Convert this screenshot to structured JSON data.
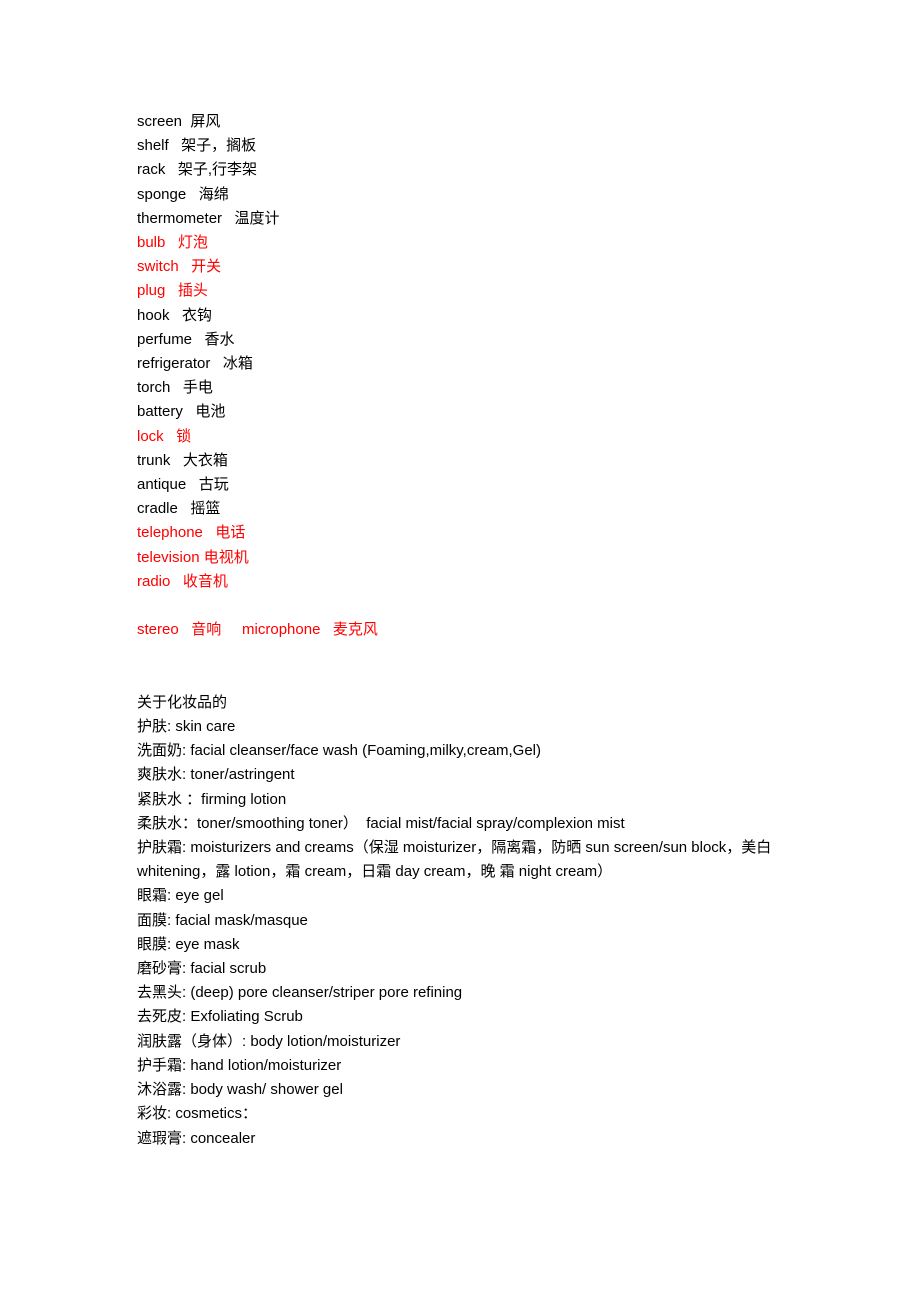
{
  "document": {
    "colors": {
      "text": "#000000",
      "highlight": "#ff0000",
      "background": "#ffffff"
    },
    "household_vocab": {
      "section_name": "household-items-vocabulary",
      "entries": [
        {
          "text": "screen  屏风",
          "highlighted": false
        },
        {
          "text": "shelf   架子，搁板",
          "highlighted": false
        },
        {
          "text": "rack   架子,行李架",
          "highlighted": false
        },
        {
          "text": "sponge   海绵",
          "highlighted": false
        },
        {
          "text": "thermometer   温度计",
          "highlighted": false
        },
        {
          "text": "bulb   灯泡",
          "highlighted": true
        },
        {
          "text": "switch   开关",
          "highlighted": true
        },
        {
          "text": "plug   插头",
          "highlighted": true
        },
        {
          "text": "hook   衣钩",
          "highlighted": false
        },
        {
          "text": "perfume   香水",
          "highlighted": false
        },
        {
          "text": "refrigerator   冰箱",
          "highlighted": false
        },
        {
          "text": "torch   手电",
          "highlighted": false
        },
        {
          "text": "battery   电池",
          "highlighted": false
        },
        {
          "text": "lock   锁",
          "highlighted": true
        },
        {
          "text": "trunk   大衣箱",
          "highlighted": false
        },
        {
          "text": "antique   古玩",
          "highlighted": false
        },
        {
          "text": "cradle   摇篮",
          "highlighted": false
        },
        {
          "text": "telephone   电话",
          "highlighted": true
        },
        {
          "text": "television 电视机",
          "highlighted": true
        },
        {
          "text": "radio   收音机",
          "highlighted": true
        }
      ],
      "audio_line": {
        "text": "stereo   音响     microphone   麦克风",
        "highlighted": true
      }
    },
    "cosmetics_vocab": {
      "section_name": "cosmetics-vocabulary",
      "heading": "关于化妆品的",
      "entries": [
        "护肤: skin care",
        "洗面奶: facial cleanser/face wash (Foaming,milky,cream,Gel)",
        "爽肤水: toner/astringent",
        "紧肤水 ：firming lotion",
        "柔肤水：toner/smoothing toner）  facial mist/facial spray/complexion mist"
      ],
      "moisturizer_paragraph": "护肤霜: moisturizers and creams（保湿 moisturizer，隔离霜，防晒 sun screen/sun block，美白 whitening，露 lotion，霜 cream，日霜 day cream，晚 霜 night cream）",
      "entries_after": [
        "眼霜: eye gel",
        "面膜: facial mask/masque",
        "眼膜: eye mask",
        "磨砂膏: facial scrub",
        "去黑头: (deep) pore cleanser/striper pore refining",
        "去死皮: Exfoliating Scrub",
        "润肤露（身体）: body lotion/moisturizer",
        "护手霜: hand lotion/moisturizer",
        "沐浴露: body wash/ shower gel",
        "彩妆: cosmetics：",
        "遮瑕膏: concealer"
      ]
    }
  }
}
